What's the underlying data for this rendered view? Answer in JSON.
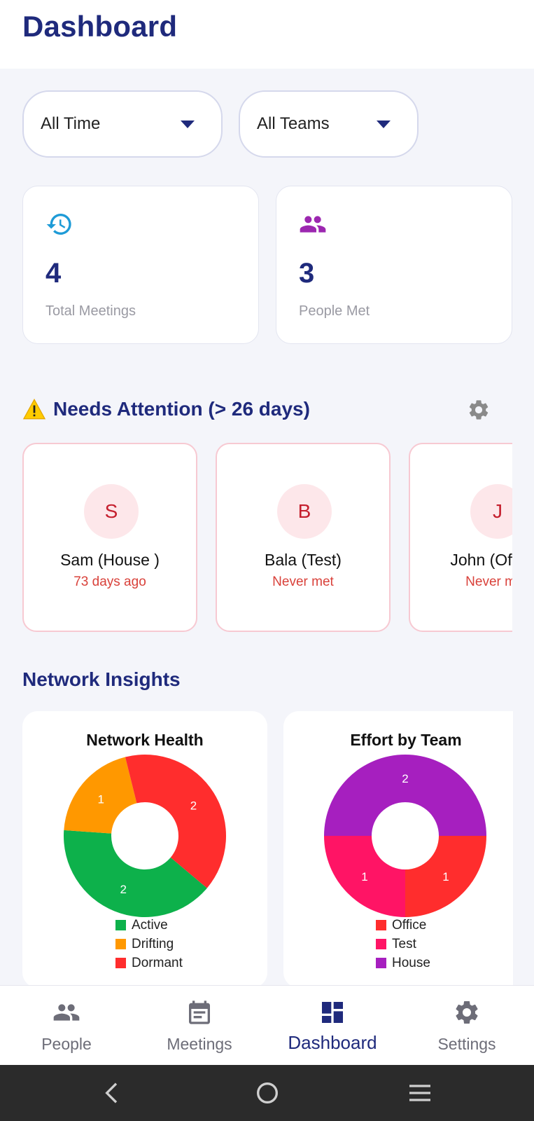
{
  "header": {
    "title": "Dashboard"
  },
  "filters": {
    "time": {
      "value": "All Time"
    },
    "team": {
      "value": "All Teams"
    }
  },
  "stats": {
    "meetings": {
      "value": "4",
      "label": "Total Meetings",
      "icon": "history-icon",
      "color": "#1e9bd7"
    },
    "people": {
      "value": "3",
      "label": "People Met",
      "icon": "group-icon",
      "color": "#9c27b0"
    }
  },
  "attention": {
    "title": "Needs Attention (> 26 days)",
    "people": [
      {
        "initial": "S",
        "name": "Sam (House )",
        "status": "73 days ago"
      },
      {
        "initial": "B",
        "name": "Bala (Test)",
        "status": "Never met"
      },
      {
        "initial": "J",
        "name": "John (Office)",
        "status": "Never met"
      }
    ]
  },
  "insights": {
    "title": "Network Insights",
    "health": {
      "title": "Network Health",
      "legend": [
        "Active",
        "Drifting",
        "Dormant"
      ]
    },
    "effort": {
      "title": "Effort by Team",
      "legend": [
        "Office",
        "Test",
        "House"
      ]
    }
  },
  "chart_data": [
    {
      "type": "pie",
      "title": "Network Health",
      "categories": [
        "Active",
        "Drifting",
        "Dormant"
      ],
      "values": [
        2,
        1,
        2
      ],
      "colors": [
        "#0db14b",
        "#ff9800",
        "#ff2d2d"
      ],
      "donut": true,
      "legend": "bottom"
    },
    {
      "type": "pie",
      "title": "Effort by Team",
      "categories": [
        "Office",
        "Test",
        "House"
      ],
      "values": [
        1,
        1,
        2
      ],
      "colors": [
        "#ff2d2d",
        "#ff1465",
        "#a61fbf"
      ],
      "donut": true,
      "legend": "bottom"
    }
  ],
  "nav": {
    "items": [
      {
        "label": "People",
        "icon": "people-icon"
      },
      {
        "label": "Meetings",
        "icon": "meetings-icon"
      },
      {
        "label": "Dashboard",
        "icon": "dashboard-icon",
        "active": true
      },
      {
        "label": "Settings",
        "icon": "settings-icon"
      }
    ]
  },
  "colors": {
    "primary": "#1f2a7c",
    "warning": "#d9413a",
    "accent_blue": "#1e9bd7",
    "accent_purple": "#9c27b0"
  }
}
